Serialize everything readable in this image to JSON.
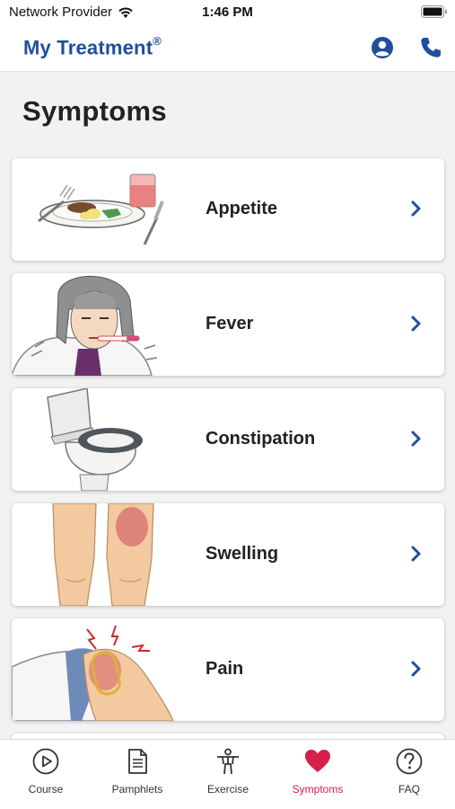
{
  "status_bar": {
    "carrier": "Network Provider",
    "time": "1:46 PM"
  },
  "header": {
    "brand": "My Treatment",
    "brand_mark": "®",
    "icons": [
      "profile-icon",
      "phone-icon"
    ]
  },
  "page": {
    "title": "Symptoms"
  },
  "symptoms": [
    {
      "label": "Appetite",
      "illustration": "meal-plate"
    },
    {
      "label": "Fever",
      "illustration": "person-with-thermometer"
    },
    {
      "label": "Constipation",
      "illustration": "toilet"
    },
    {
      "label": "Swelling",
      "illustration": "swollen-legs"
    },
    {
      "label": "Pain",
      "illustration": "painful-knee"
    }
  ],
  "tab_bar": {
    "active": "Symptoms",
    "tabs": [
      {
        "label": "Course",
        "icon": "play-circle-icon"
      },
      {
        "label": "Pamphlets",
        "icon": "document-icon"
      },
      {
        "label": "Exercise",
        "icon": "person-icon"
      },
      {
        "label": "Symptoms",
        "icon": "heart-icon"
      },
      {
        "label": "FAQ",
        "icon": "question-circle-icon"
      }
    ]
  },
  "colors": {
    "brand_blue": "#1f4e9c",
    "active_tab": "#d61f4b",
    "background": "#f2f2f2"
  }
}
